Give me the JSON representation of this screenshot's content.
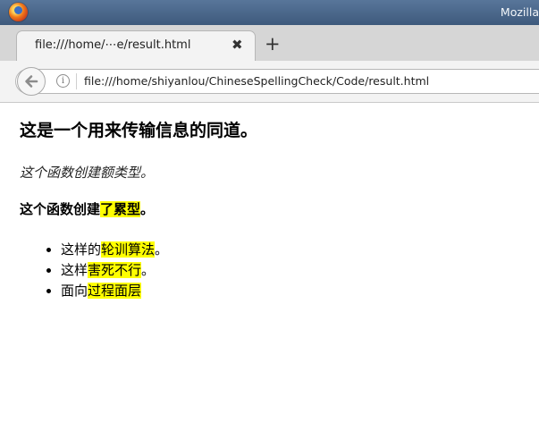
{
  "window": {
    "title": "Mozilla"
  },
  "tabs": [
    {
      "label": "file:///home/⋯e/result.html",
      "close_glyph": "✖"
    }
  ],
  "new_tab_glyph": "+",
  "urlbar": {
    "url": "file:///home/shiyanlou/ChineseSpellingCheck/Code/result.html",
    "info_glyph": "i"
  },
  "page": {
    "heading": "这是一个用来传输信息的同道。",
    "italic_line": "这个函数创建额类型。",
    "bold_line": {
      "before": "这个函数创建",
      "highlight": "了累型",
      "after": "。"
    },
    "list": [
      {
        "before": "这样的",
        "highlight": "轮训算法",
        "after": "。"
      },
      {
        "before": "这样",
        "highlight": "害死不行",
        "after": "。"
      },
      {
        "before": "面向",
        "highlight": "过程面层",
        "after": ""
      }
    ],
    "highlight_color": "#ffff00"
  },
  "colors": {
    "titlebar": "#4a6788",
    "tabstrip": "#d6d6d6",
    "toolbar": "#f3f3f3"
  },
  "icons": {
    "app": "firefox-logo-icon",
    "back": "back-arrow-icon",
    "info": "info-icon",
    "close": "close-icon",
    "new_tab": "plus-icon"
  }
}
